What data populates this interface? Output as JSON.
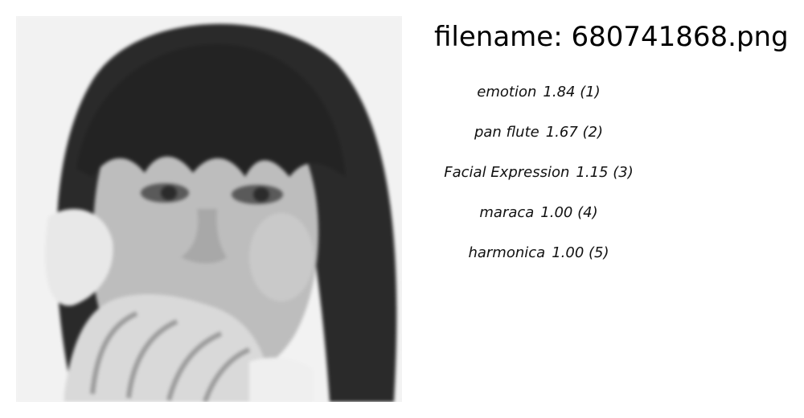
{
  "header": {
    "filename_text": "filename: 680741868.png"
  },
  "photo": {
    "subject": "grayscale photo of a woman with dark bangs covering her mouth with her hands"
  },
  "predictions": [
    {
      "label": "emotion",
      "score": "1.84",
      "rank": "(1)"
    },
    {
      "label": "pan flute",
      "score": "1.67",
      "rank": "(2)"
    },
    {
      "label": "Facial Expression",
      "score": "1.15",
      "rank": "(3)"
    },
    {
      "label": "maraca",
      "score": "1.00",
      "rank": "(4)"
    },
    {
      "label": "harmonica",
      "score": "1.00",
      "rank": "(5)"
    }
  ]
}
